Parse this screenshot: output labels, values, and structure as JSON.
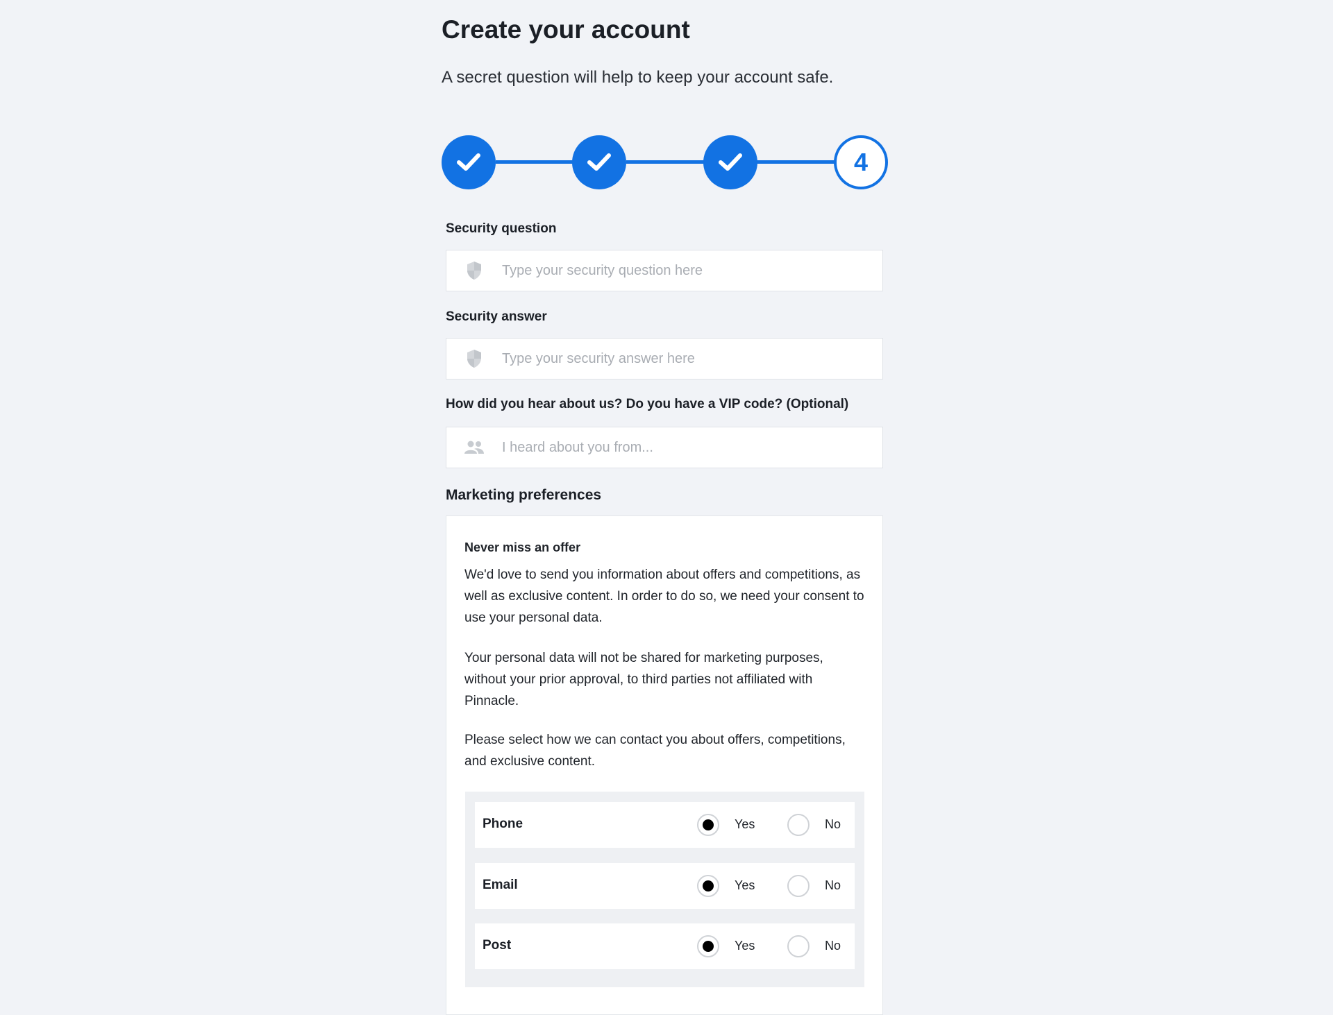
{
  "header": {
    "title": "Create your account",
    "subtitle": "A secret question will help to keep your account safe."
  },
  "stepper": {
    "accent_color": "#1272e3",
    "steps": [
      {
        "state": "complete",
        "icon": "check-icon"
      },
      {
        "state": "complete",
        "icon": "check-icon"
      },
      {
        "state": "complete",
        "icon": "check-icon"
      },
      {
        "state": "current",
        "label": "4"
      }
    ]
  },
  "form": {
    "security_question": {
      "label": "Security question",
      "placeholder": "Type your security question here",
      "value": "",
      "icon": "shield-icon"
    },
    "security_answer": {
      "label": "Security answer",
      "placeholder": "Type your security answer here",
      "value": "",
      "icon": "shield-icon"
    },
    "referral": {
      "label": "How did you hear about us? Do you have a VIP code? (Optional)",
      "placeholder": "I heard about you from...",
      "value": "",
      "icon": "users-icon"
    }
  },
  "marketing": {
    "heading": "Marketing preferences",
    "card_title": "Never miss an offer",
    "paragraphs": [
      "We'd love to send you information about offers and competitions, as well as exclusive content. In order to do so, we need your consent to use your personal data.",
      "Your personal data will not be shared for marketing purposes, without your prior approval, to third parties not affiliated with Pinnacle.",
      "Please select how we can contact you about offers, competitions, and exclusive content."
    ],
    "yes_label": "Yes",
    "no_label": "No",
    "channels": [
      {
        "name": "Phone",
        "selected": "Yes"
      },
      {
        "name": "Email",
        "selected": "Yes"
      },
      {
        "name": "Post",
        "selected": "Yes"
      }
    ]
  }
}
